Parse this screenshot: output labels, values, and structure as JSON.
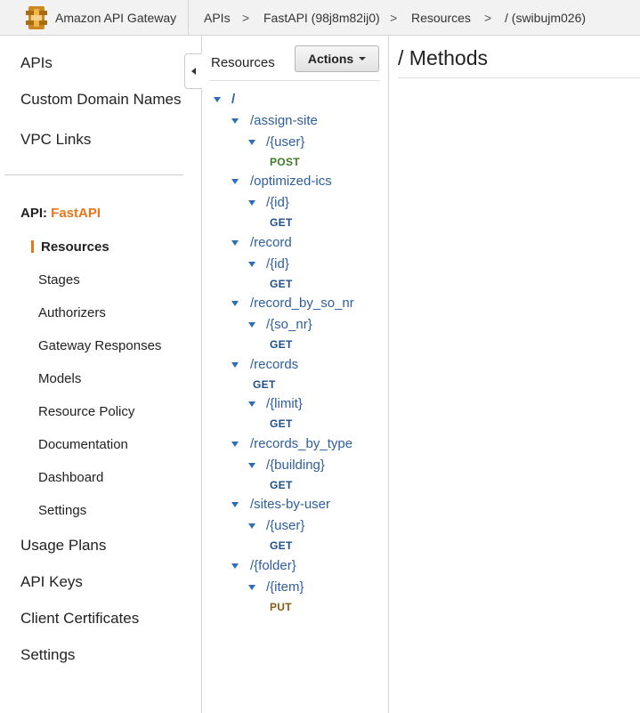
{
  "header": {
    "brand": "Amazon API Gateway",
    "breadcrumbs": [
      "APIs",
      "FastAPI (98j8m82ij0)",
      "Resources",
      "/ (swibujm026)"
    ],
    "separator": ">"
  },
  "sidebar": {
    "top_items": [
      {
        "label": "APIs"
      },
      {
        "label": "Custom Domain Names"
      },
      {
        "label": "VPC Links"
      }
    ],
    "api_prefix": "API:",
    "api_name": "FastAPI",
    "api_items": [
      {
        "label": "Resources",
        "active": true
      },
      {
        "label": "Stages"
      },
      {
        "label": "Authorizers"
      },
      {
        "label": "Gateway Responses"
      },
      {
        "label": "Models"
      },
      {
        "label": "Resource Policy"
      },
      {
        "label": "Documentation"
      },
      {
        "label": "Dashboard"
      },
      {
        "label": "Settings"
      }
    ],
    "bottom_items": [
      {
        "label": "Usage Plans"
      },
      {
        "label": "API Keys"
      },
      {
        "label": "Client Certificates"
      },
      {
        "label": "Settings"
      }
    ]
  },
  "resources_panel": {
    "title": "Resources",
    "actions_label": "Actions",
    "tree": [
      {
        "type": "resource",
        "label": "/"
      },
      {
        "type": "resource",
        "label": "/assign-site"
      },
      {
        "type": "resource",
        "label": "/{user}"
      },
      {
        "type": "method",
        "label": "POST"
      },
      {
        "type": "resource",
        "label": "/optimized-ics"
      },
      {
        "type": "resource",
        "label": "/{id}"
      },
      {
        "type": "method",
        "label": "GET"
      },
      {
        "type": "resource",
        "label": "/record"
      },
      {
        "type": "resource",
        "label": "/{id}"
      },
      {
        "type": "method",
        "label": "GET"
      },
      {
        "type": "resource",
        "label": "/record_by_so_nr"
      },
      {
        "type": "resource",
        "label": "/{so_nr}"
      },
      {
        "type": "method",
        "label": "GET"
      },
      {
        "type": "resource",
        "label": "/records"
      },
      {
        "type": "method",
        "label": "GET"
      },
      {
        "type": "resource",
        "label": "/{limit}"
      },
      {
        "type": "method",
        "label": "GET"
      },
      {
        "type": "resource",
        "label": "/records_by_type"
      },
      {
        "type": "resource",
        "label": "/{building}"
      },
      {
        "type": "method",
        "label": "GET"
      },
      {
        "type": "resource",
        "label": "/sites-by-user"
      },
      {
        "type": "resource",
        "label": "/{user}"
      },
      {
        "type": "method",
        "label": "GET"
      },
      {
        "type": "resource",
        "label": "/{folder}"
      },
      {
        "type": "resource",
        "label": "/{item}"
      },
      {
        "type": "method",
        "label": "PUT"
      }
    ]
  },
  "main": {
    "title": "/ Methods"
  },
  "colors": {
    "accent": "#e8761b",
    "link": "#2d5e9e",
    "get": "#1f4f86",
    "post": "#3c7a2a",
    "put": "#8a5b14"
  },
  "icons": [
    "api-gateway-logo-icon",
    "collapse-left-icon",
    "caret-down-icon",
    "expand-triangle-icon"
  ]
}
